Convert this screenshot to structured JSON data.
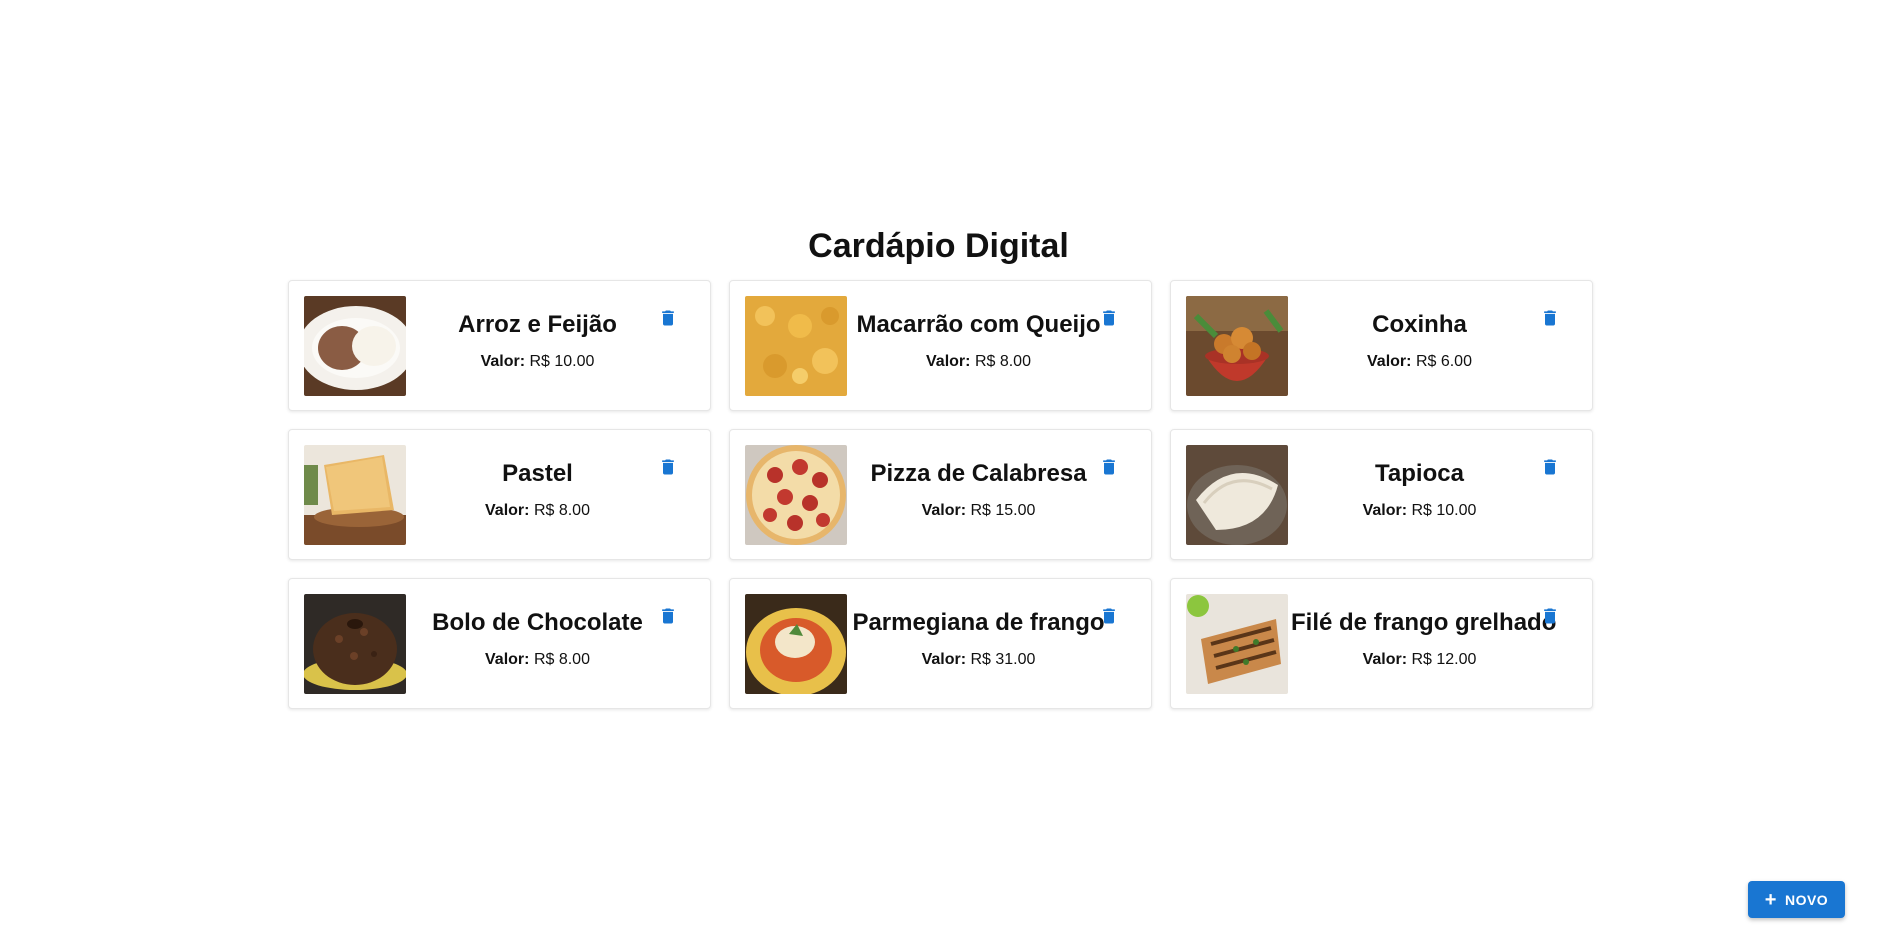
{
  "page": {
    "title": "Cardápio Digital"
  },
  "items": [
    {
      "name": "Arroz e Feijão",
      "price_label": "Valor:",
      "price": "R$ 10.00",
      "image": "arroz-feijao-photo"
    },
    {
      "name": "Macarrão com Queijo",
      "price_label": "Valor:",
      "price": "R$ 8.00",
      "image": "mac-cheese-photo"
    },
    {
      "name": "Coxinha",
      "price_label": "Valor:",
      "price": "R$ 6.00",
      "image": "coxinha-photo"
    },
    {
      "name": "Pastel",
      "price_label": "Valor:",
      "price": "R$ 8.00",
      "image": "pastel-photo"
    },
    {
      "name": "Pizza de Calabresa",
      "price_label": "Valor:",
      "price": "R$ 15.00",
      "image": "pizza-photo"
    },
    {
      "name": "Tapioca",
      "price_label": "Valor:",
      "price": "R$ 10.00",
      "image": "tapioca-photo"
    },
    {
      "name": "Bolo de Chocolate",
      "price_label": "Valor:",
      "price": "R$ 8.00",
      "image": "bolo-photo"
    },
    {
      "name": "Parmegiana de frango",
      "price_label": "Valor:",
      "price": "R$ 31.00",
      "image": "parmegiana-photo"
    },
    {
      "name": "Filé de frango grelhado",
      "price_label": "Valor:",
      "price": "R$ 12.00",
      "image": "file-frango-photo"
    }
  ],
  "actions": {
    "new_label": "NOVO",
    "new_icon": "plus-icon",
    "delete_icon": "trash-icon"
  },
  "colors": {
    "accent": "#1976d2",
    "text": "#111111",
    "background": "#ffffff"
  }
}
